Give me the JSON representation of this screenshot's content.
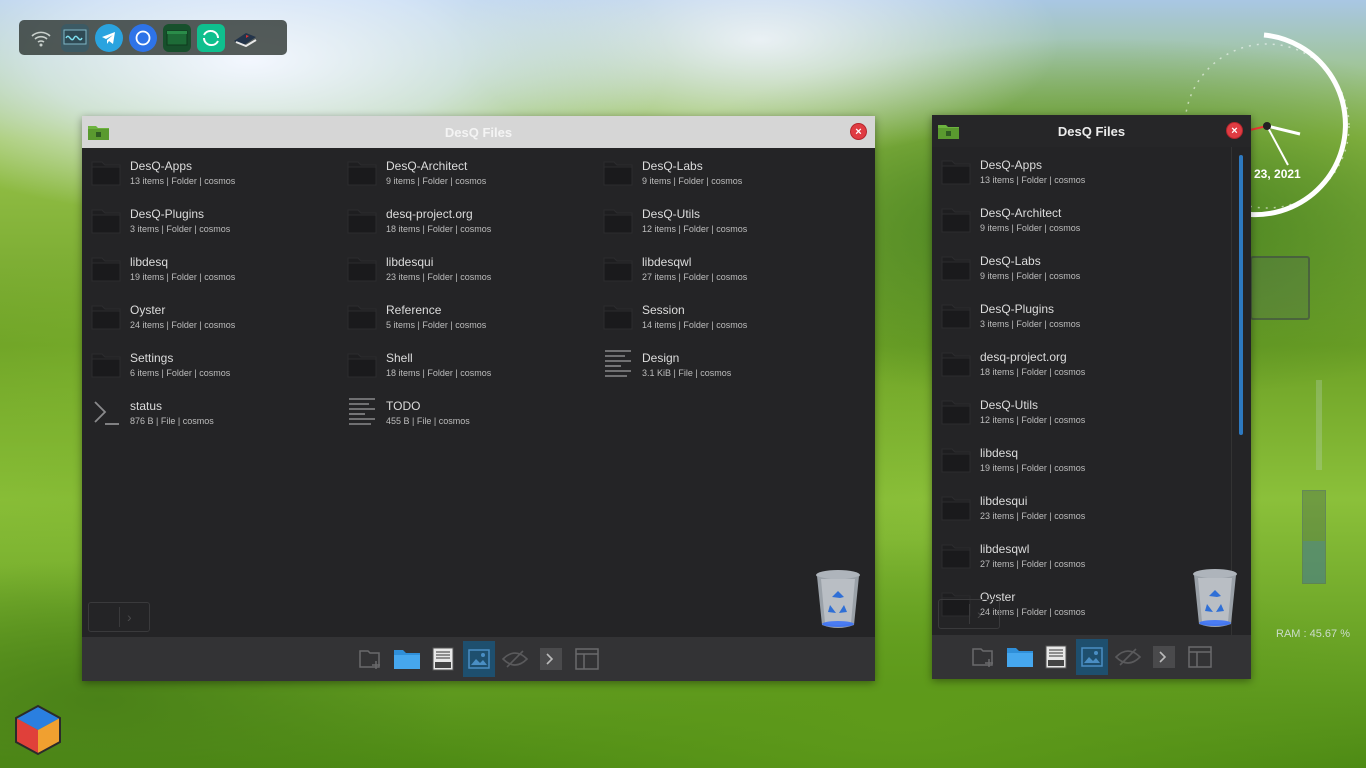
{
  "dock": {
    "icons": [
      "wifi-icon",
      "system-monitor-icon",
      "telegram-icon",
      "signal-icon",
      "terminal-icon",
      "element-icon",
      "reader-icon"
    ]
  },
  "clock": {
    "date_fragment": "23, 2021"
  },
  "ram": {
    "label": "RAM : 45.67 %",
    "fraction": 0.4567
  },
  "window_main": {
    "title": "DesQ Files",
    "close_label": "×",
    "items": [
      {
        "name": "DesQ-Apps",
        "meta": "13 items | Folder | cosmos",
        "type": "folder"
      },
      {
        "name": "DesQ-Architect",
        "meta": "9 items | Folder | cosmos",
        "type": "folder"
      },
      {
        "name": "DesQ-Labs",
        "meta": "9 items | Folder | cosmos",
        "type": "folder"
      },
      {
        "name": "DesQ-Plugins",
        "meta": "3 items | Folder | cosmos",
        "type": "folder"
      },
      {
        "name": "desq-project.org",
        "meta": "18 items | Folder | cosmos",
        "type": "folder"
      },
      {
        "name": "DesQ-Utils",
        "meta": "12 items | Folder | cosmos",
        "type": "folder"
      },
      {
        "name": "libdesq",
        "meta": "19 items | Folder | cosmos",
        "type": "folder"
      },
      {
        "name": "libdesqui",
        "meta": "23 items | Folder | cosmos",
        "type": "folder"
      },
      {
        "name": "libdesqwl",
        "meta": "27 items | Folder | cosmos",
        "type": "folder"
      },
      {
        "name": "Oyster",
        "meta": "24 items | Folder | cosmos",
        "type": "folder"
      },
      {
        "name": "Reference",
        "meta": "5 items | Folder | cosmos",
        "type": "folder"
      },
      {
        "name": "Session",
        "meta": "14 items | Folder | cosmos",
        "type": "folder"
      },
      {
        "name": "Settings",
        "meta": "6 items | Folder | cosmos",
        "type": "folder"
      },
      {
        "name": "Shell",
        "meta": "18 items | Folder | cosmos",
        "type": "folder"
      },
      {
        "name": "Design",
        "meta": "3.1 KiB | File | cosmos",
        "type": "text"
      },
      {
        "name": "status",
        "meta": "876 B | File | cosmos",
        "type": "script"
      },
      {
        "name": "TODO",
        "meta": "455 B | File | cosmos",
        "type": "text"
      }
    ],
    "toolbar": [
      "new-folder-icon",
      "folder-icon",
      "save-drive-icon",
      "image-preview-icon",
      "hidden-files-icon",
      "terminal-icon",
      "side-panel-icon"
    ],
    "active_tool": 3
  },
  "window_side": {
    "title": "DesQ Files",
    "close_label": "×",
    "items": [
      {
        "name": "DesQ-Apps",
        "meta": "13 items | Folder | cosmos"
      },
      {
        "name": "DesQ-Architect",
        "meta": "9 items | Folder | cosmos"
      },
      {
        "name": "DesQ-Labs",
        "meta": "9 items | Folder | cosmos"
      },
      {
        "name": "DesQ-Plugins",
        "meta": "3 items | Folder | cosmos"
      },
      {
        "name": "desq-project.org",
        "meta": "18 items | Folder | cosmos"
      },
      {
        "name": "DesQ-Utils",
        "meta": "12 items | Folder | cosmos"
      },
      {
        "name": "libdesq",
        "meta": "19 items | Folder | cosmos"
      },
      {
        "name": "libdesqui",
        "meta": "23 items | Folder | cosmos"
      },
      {
        "name": "libdesqwl",
        "meta": "27 items | Folder | cosmos"
      },
      {
        "name": "Oyster",
        "meta": "24 items | Folder | cosmos"
      }
    ],
    "toolbar": [
      "new-folder-icon",
      "folder-icon",
      "save-drive-icon",
      "image-preview-icon",
      "hidden-files-icon",
      "terminal-icon",
      "side-panel-icon"
    ],
    "active_tool": 3
  }
}
